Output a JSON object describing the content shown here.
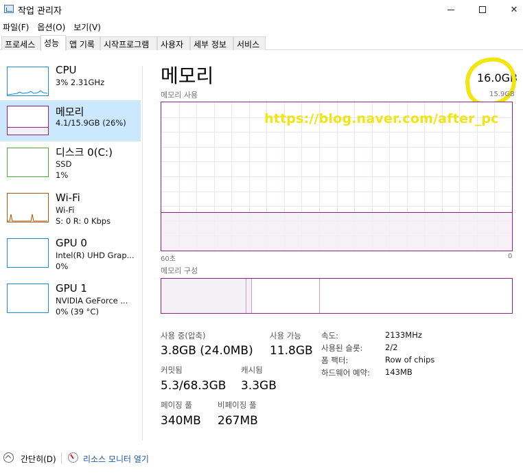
{
  "window": {
    "title": "작업 관리자"
  },
  "menu": [
    "파일(F)",
    "옵션(O)",
    "보기(V)"
  ],
  "tabs": [
    "프로세스",
    "성능",
    "앱 기록",
    "시작프로그램",
    "사용자",
    "세부 정보",
    "서비스"
  ],
  "sidebar": {
    "items": [
      {
        "title": "CPU",
        "sub1": "3% 2.31GHz",
        "sub2": "",
        "sub3": "",
        "color": "#1a8bd6"
      },
      {
        "title": "메모리",
        "sub1": "4.1/15.9GB (26%)",
        "sub2": "",
        "sub3": "",
        "color": "#8b1f8b"
      },
      {
        "title": "디스크 0(C:)",
        "sub1": "SSD",
        "sub2": "1%",
        "sub3": "",
        "color": "#4da936"
      },
      {
        "title": "Wi-Fi",
        "sub1": "Wi-Fi",
        "sub2": "S: 0 R: 0 Kbps",
        "sub3": "",
        "color": "#a7580f"
      },
      {
        "title": "GPU 0",
        "sub1": "Intel(R) UHD Grap...",
        "sub2": "0%",
        "sub3": "",
        "color": "#1a8bd6"
      },
      {
        "title": "GPU 1",
        "sub1": "NVIDIA GeForce ...",
        "sub2": "0% (39 °C)",
        "sub3": "",
        "color": "#1a8bd6"
      }
    ]
  },
  "main": {
    "title": "메모리",
    "total": "16.0GB",
    "usage_label": "메모리 사용",
    "max_label": "15.9GB",
    "watermark": "https://blog.naver.com/after_pc",
    "time_left": "60초",
    "time_right": "0",
    "composition_label": "메모리 구성",
    "usage_fraction": 0.26
  },
  "stats": {
    "in_use_label": "사용 중(압축)",
    "in_use_value": "3.8GB (24.0MB)",
    "available_label": "사용 가능",
    "available_value": "11.8GB",
    "committed_label": "커밋됨",
    "committed_value": "5.3/68.3GB",
    "cached_label": "캐시됨",
    "cached_value": "3.3GB",
    "paged_label": "페이징 풀",
    "paged_value": "340MB",
    "nonpaged_label": "비페이징 풀",
    "nonpaged_value": "267MB"
  },
  "info": [
    {
      "key": "속도:",
      "value": "2133MHz"
    },
    {
      "key": "사용된 슬롯:",
      "value": "2/2"
    },
    {
      "key": "폼 팩터:",
      "value": "Row of chips"
    },
    {
      "key": "하드웨어 예약:",
      "value": "143MB"
    }
  ],
  "footer": {
    "collapse_label": "간단히(D)",
    "monitor_label": "리소스 모니터 열기"
  }
}
